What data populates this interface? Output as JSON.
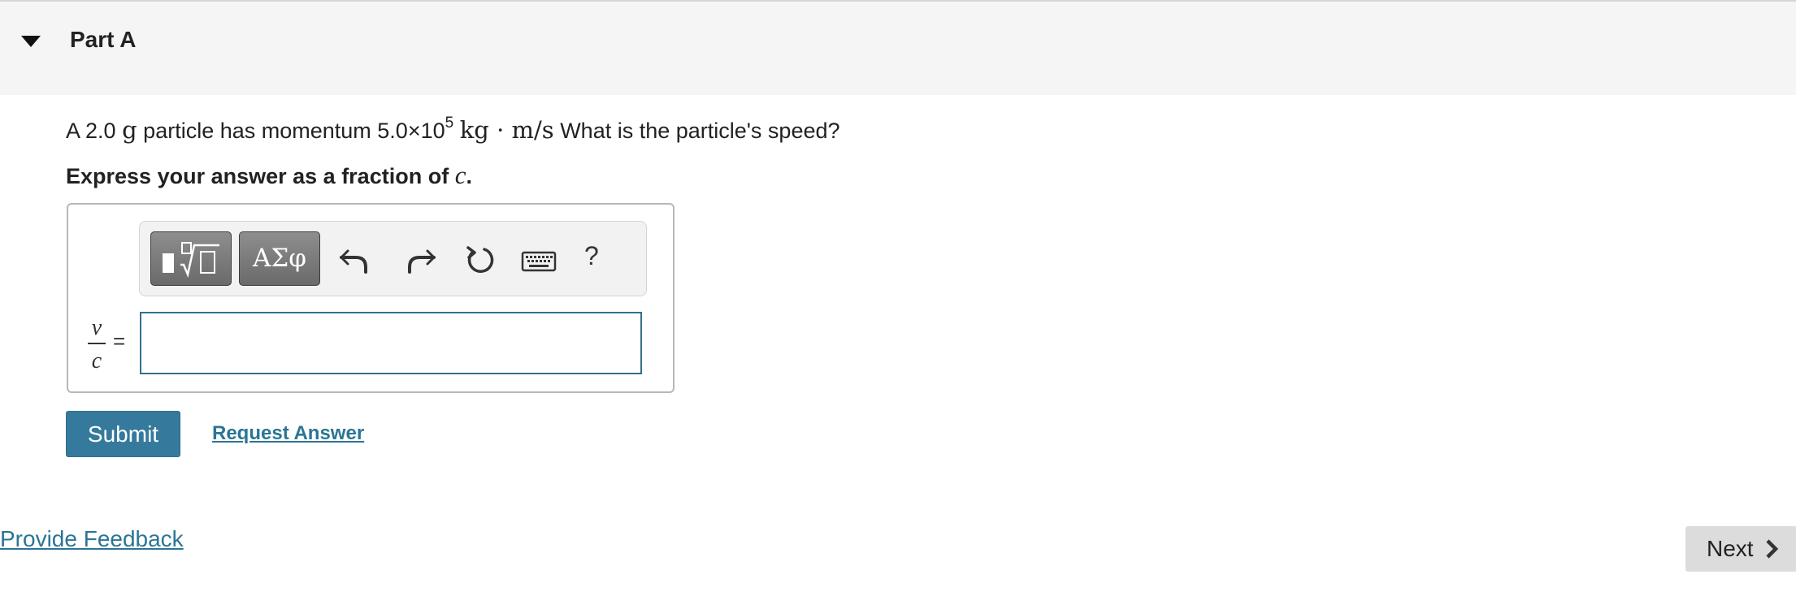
{
  "part": {
    "title": "Part A"
  },
  "question": {
    "prefix": "A 2.0",
    "mass_unit": "g",
    "middle": "particle has momentum 5.0×10",
    "exponent": "5",
    "momentum_unit": "kg · m/s",
    "suffix": "What is the particle's speed?"
  },
  "instruction": {
    "text": "Express your answer as a fraction of",
    "variable": "c",
    "period": "."
  },
  "toolbar": {
    "greek_label": "ΑΣφ",
    "help_label": "?",
    "icons": [
      "templates-icon",
      "greek-letters-icon",
      "undo-icon",
      "redo-icon",
      "reset-icon",
      "keyboard-icon",
      "help-icon"
    ]
  },
  "answer": {
    "numerator": "v",
    "denominator": "c",
    "equals": "=",
    "value": "",
    "placeholder": ""
  },
  "actions": {
    "submit_label": "Submit",
    "request_label": "Request Answer"
  },
  "footer": {
    "feedback_label": "Provide Feedback",
    "next_label": "Next"
  },
  "colors": {
    "accent": "#357a9c",
    "link": "#2b7595",
    "header_bg": "#f5f5f5",
    "input_border": "#336f8f"
  }
}
